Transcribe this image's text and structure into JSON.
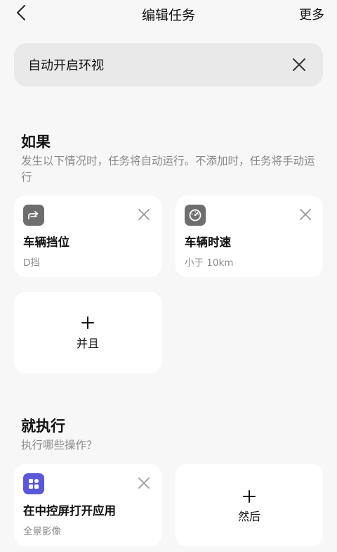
{
  "header": {
    "title": "编辑任务",
    "more_label": "更多"
  },
  "task_name": {
    "value": "自动开启环视"
  },
  "if_section": {
    "title": "如果",
    "description": "发生以下情况时，任务将自动运行。不添加时，任务将手动运行",
    "conditions": [
      {
        "title": "车辆挡位",
        "subtitle": "D挡",
        "icon": "gear-shift-icon",
        "icon_color": "#6e6e6e"
      },
      {
        "title": "车辆时速",
        "subtitle": "小于 10km",
        "icon": "speedometer-icon",
        "icon_color": "#6e6e6e"
      }
    ],
    "add_label": "并且"
  },
  "then_section": {
    "title": "就执行",
    "description": "执行哪些操作？",
    "actions": [
      {
        "title": "在中控屏打开应用",
        "subtitle": "全景影像",
        "icon": "apps-grid-icon",
        "icon_color": "#5b57d9"
      }
    ],
    "add_label": "然后"
  }
}
